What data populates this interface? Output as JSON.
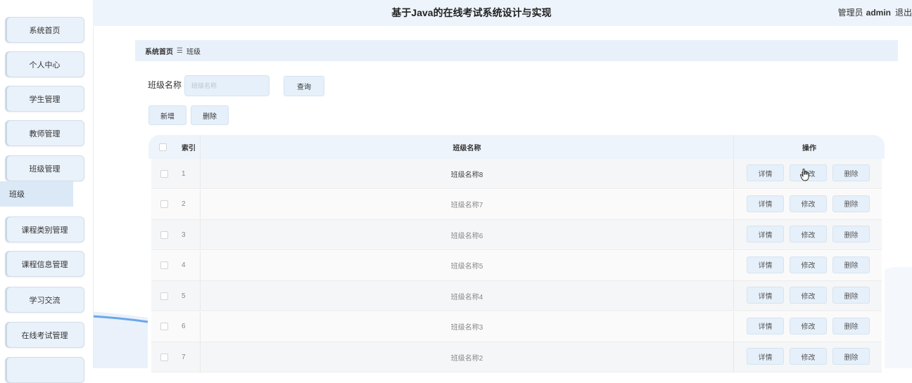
{
  "header": {
    "title": "基于Java的在线考试系统设计与实现",
    "role": "管理员",
    "username": "admin",
    "logout": "退出"
  },
  "sidebar": {
    "items": [
      {
        "label": "系统首页"
      },
      {
        "label": "个人中心"
      },
      {
        "label": "学生管理"
      },
      {
        "label": "教师管理"
      },
      {
        "label": "班级管理"
      },
      {
        "label": "课程类别管理"
      },
      {
        "label": "课程信息管理"
      },
      {
        "label": "学习交流"
      },
      {
        "label": "在线考试管理"
      }
    ],
    "sub_item": "班级"
  },
  "breadcrumb": {
    "home": "系统首页",
    "separator": "☰",
    "current": "班级"
  },
  "search": {
    "label": "班级名称",
    "placeholder": "班级名称",
    "query_button": "查询"
  },
  "actions": {
    "add": "新增",
    "delete": "删除"
  },
  "table": {
    "headers": {
      "index": "索引",
      "name": "班级名称",
      "operation": "操作"
    },
    "op_labels": {
      "detail": "详情",
      "edit": "修改",
      "delete": "删除"
    },
    "rows": [
      {
        "index": "1",
        "name": "班级名称8"
      },
      {
        "index": "2",
        "name": "班级名称7"
      },
      {
        "index": "3",
        "name": "班级名称6"
      },
      {
        "index": "4",
        "name": "班级名称5"
      },
      {
        "index": "5",
        "name": "班级名称4"
      },
      {
        "index": "6",
        "name": "班级名称3"
      },
      {
        "index": "7",
        "name": "班级名称2"
      }
    ]
  }
}
